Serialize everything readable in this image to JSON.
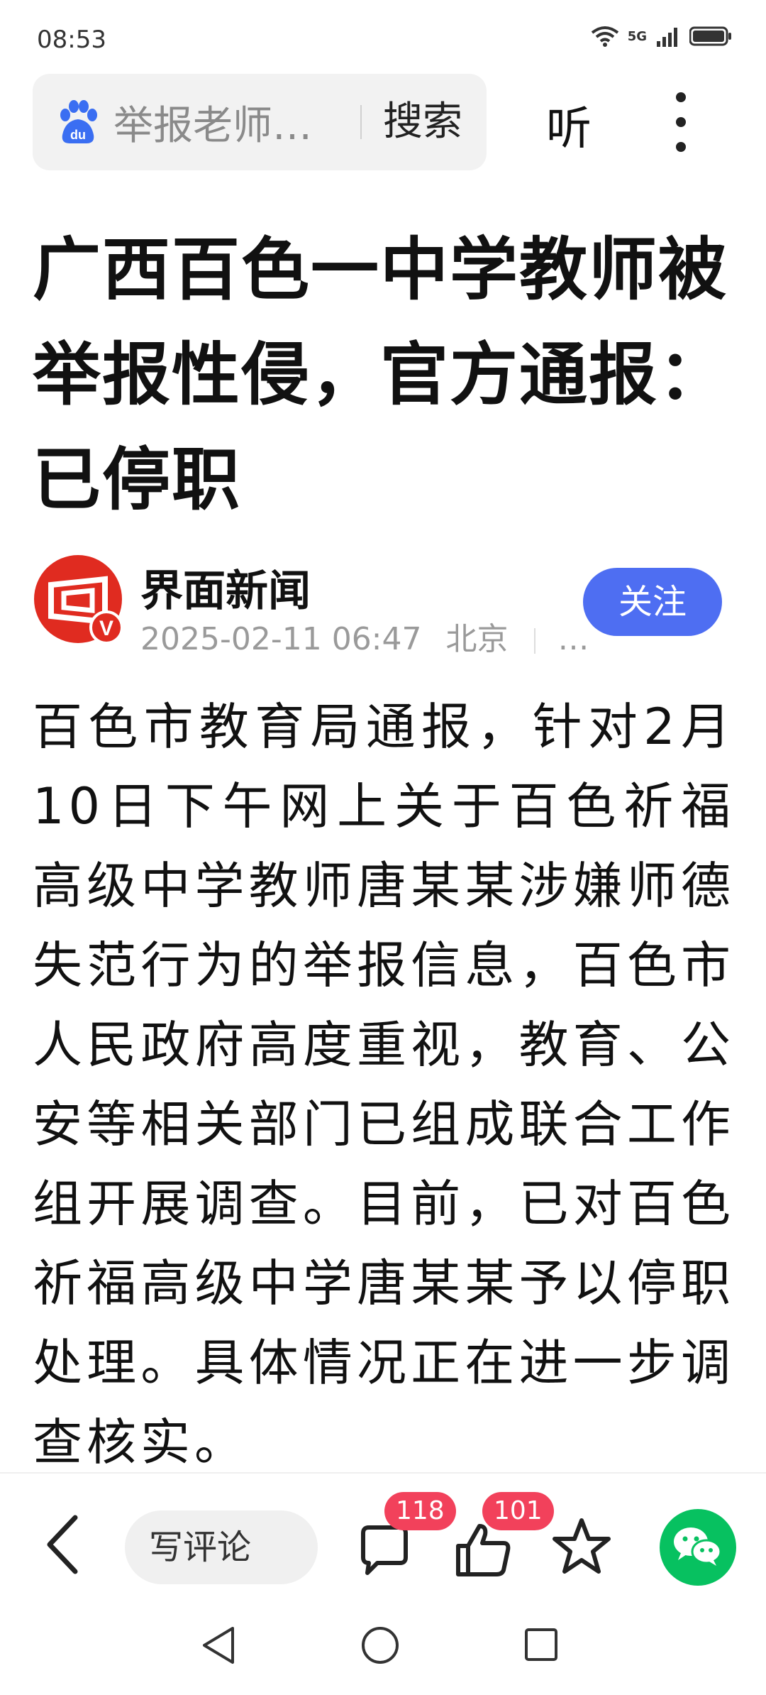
{
  "status_bar": {
    "time": "08:53",
    "network": "5G"
  },
  "search": {
    "query": "举报老师…",
    "button_label": "搜索",
    "logo": "baidu-paw-icon"
  },
  "header": {
    "listen_label": "听",
    "more_icon": "more-vertical-icon"
  },
  "article": {
    "title": "广西百色一中学教师被举报性侵，官方通报：已停职",
    "author": "界面新闻",
    "datetime": "2025-02-11 06:47",
    "location": "北京",
    "meta_more": "…",
    "follow_label": "关注",
    "body": "百色市教育局通报，针对2月10日下午网上关于百色祈福高级中学教师唐某某涉嫌师德失范行为的举报信息，百色市人民政府高度重视，教育、公安等相关部门已组成联合工作组开展调查。目前，已对百色祈福高级中学唐某某予以停职处理。具体情况正在进一步调查核实。"
  },
  "toolbar": {
    "comment_placeholder": "写评论",
    "comment_count": "118",
    "like_count": "101"
  },
  "colors": {
    "accent": "#4e6ef2",
    "badge": "#f2415b",
    "wechat": "#07c160",
    "avatar_red": "#e02b20"
  }
}
